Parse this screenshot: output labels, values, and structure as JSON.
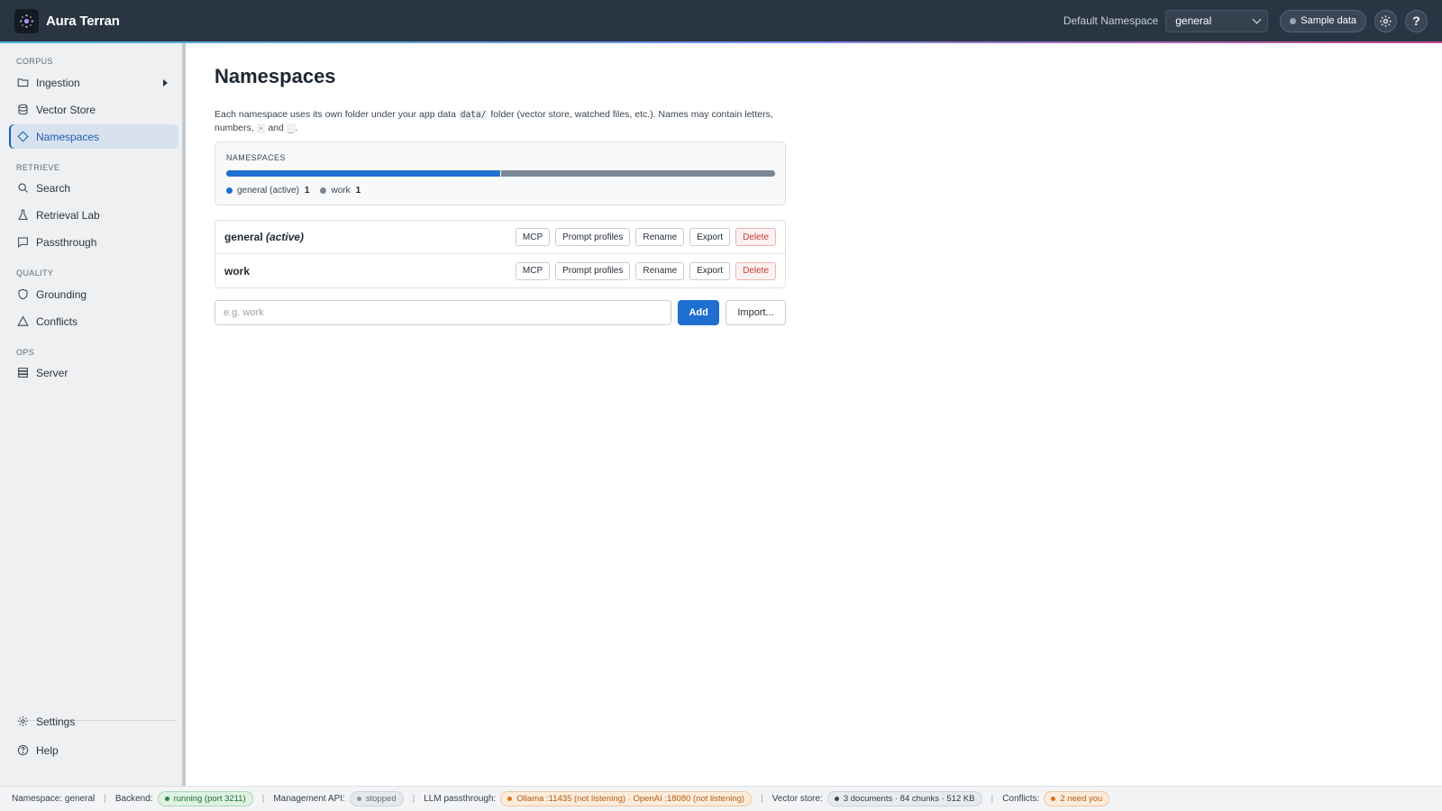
{
  "app": {
    "title": "Aura Terran",
    "logo_icon": "sparkle-logo-icon"
  },
  "header": {
    "namespace_label": "Default Namespace",
    "namespace_value": "general",
    "sample_label": "Sample data",
    "settings_icon": "gear-icon",
    "help_label": "?"
  },
  "sidebar": {
    "sections": [
      "CORPUS",
      "RETRIEVE",
      "QUALITY",
      "OPS"
    ],
    "items": [
      {
        "label": "Ingestion",
        "icon": "folder-icon"
      },
      {
        "label": "Vector Store",
        "icon": "database-icon"
      },
      {
        "label": "Namespaces",
        "icon": "tag-icon",
        "active": true
      },
      {
        "label": "Search",
        "icon": "search-icon"
      },
      {
        "label": "Retrieval Lab",
        "icon": "flask-icon"
      },
      {
        "label": "Passthrough",
        "icon": "message-icon"
      },
      {
        "label": "Grounding",
        "icon": "shield-icon"
      },
      {
        "label": "Conflicts",
        "icon": "warning-icon"
      },
      {
        "label": "Server",
        "icon": "server-icon"
      }
    ],
    "footer": [
      {
        "label": "Settings",
        "icon": "gear-icon"
      },
      {
        "label": "Help",
        "icon": "help-icon"
      }
    ]
  },
  "main": {
    "title": "Namespaces",
    "desc_part1": "Each namespace uses its own folder under your app data ",
    "desc_code1": "data/",
    "desc_part2": " folder (vector store, watched files, etc.). Names may contain letters, numbers, ",
    "desc_code2": "-",
    "desc_part3": " and ",
    "desc_code3": "_",
    "desc_part4": ".",
    "summary": {
      "title": "NAMESPACES",
      "items": [
        {
          "name": "general (active)",
          "count": "1",
          "value": 1,
          "color": "#1f6fd1"
        },
        {
          "name": "work",
          "count": "1",
          "value": 1,
          "color": "#7b8794"
        }
      ]
    },
    "rows": [
      {
        "name": "general",
        "suffix": "(active)"
      },
      {
        "name": "work",
        "suffix": ""
      }
    ],
    "row_buttons": {
      "mcp": "MCP",
      "prompt": "Prompt profiles",
      "rename": "Rename",
      "export": "Export",
      "delete": "Delete"
    },
    "add_placeholder": "e.g. work",
    "add_label": "Add",
    "import_label": "Import..."
  },
  "status": {
    "namespace": "Namespace: general",
    "backend_label": "Backend:",
    "backend_value": "running (port 3211)",
    "mgmt_label": "Management API:",
    "mgmt_value": "stopped",
    "llm_label": "LLM passthrough:",
    "llm_value": "Ollama :11435 (not listening) · OpenAI :18080 (not listening)",
    "vector_label": "Vector store:",
    "vector_value": "3 documents · 84 chunks · 512 KB",
    "conflicts_label": "Conflicts:",
    "conflicts_value": "2 need you"
  }
}
